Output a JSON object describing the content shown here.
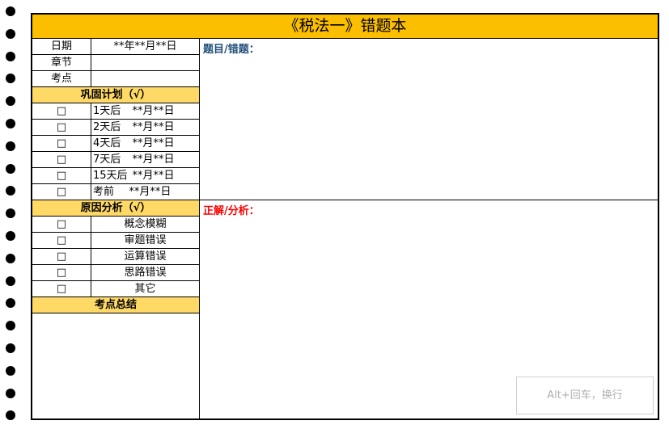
{
  "title": "《税法一》错题本",
  "info": [
    {
      "label": "日期",
      "value": "**年**月**日"
    },
    {
      "label": "章节",
      "value": ""
    },
    {
      "label": "考点",
      "value": ""
    }
  ],
  "plan": {
    "header": "巩固计划（√）",
    "checkbox": "□",
    "items": [
      {
        "when": "1天后",
        "date": "  **月**日"
      },
      {
        "when": "2天后",
        "date": "  **月**日"
      },
      {
        "when": "4天后",
        "date": "  **月**日"
      },
      {
        "when": "7天后",
        "date": "  **月**日"
      },
      {
        "when": "15天后",
        "date": "**月**日"
      },
      {
        "when": "考前",
        "date": "   **月**日"
      }
    ]
  },
  "reasons": {
    "header": "原因分析（√）",
    "items": [
      "概念模糊",
      "审题错误",
      "运算错误",
      "思路错误",
      "其它"
    ]
  },
  "summary_header": "考点总结",
  "question_label": "题目/错题：",
  "answer_label": "正解/分析：",
  "tooltip": "Alt+回车，换行",
  "colors": {
    "title_bg": "#FBBF00",
    "section_bg": "#FFD966",
    "question": "#1F4E79",
    "answer": "#FF0000"
  }
}
